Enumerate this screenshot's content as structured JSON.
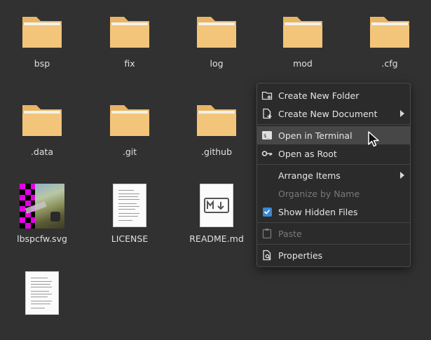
{
  "files": [
    {
      "name": "bsp",
      "type": "folder"
    },
    {
      "name": "fix",
      "type": "folder"
    },
    {
      "name": "log",
      "type": "folder"
    },
    {
      "name": "mod",
      "type": "folder"
    },
    {
      "name": ".cfg",
      "type": "folder"
    },
    {
      "name": ".data",
      "type": "folder"
    },
    {
      "name": ".git",
      "type": "folder"
    },
    {
      "name": ".github",
      "type": "folder"
    },
    {
      "name": "lbspcfw.svg",
      "type": "image"
    },
    {
      "name": "LICENSE",
      "type": "text-document"
    },
    {
      "name": "README.md",
      "type": "markdown-document"
    },
    {
      "name": "",
      "type": "text-document"
    }
  ],
  "menu": {
    "items": [
      {
        "label": "Create New Folder",
        "icon": "folder-plus-icon"
      },
      {
        "label": "Create New Document",
        "icon": "document-plus-icon",
        "submenu": true
      },
      {
        "label": "Open in Terminal",
        "icon": "terminal-icon",
        "highlighted": true
      },
      {
        "label": "Open as Root",
        "icon": "key-icon"
      },
      {
        "label": "Arrange Items",
        "submenu": true
      },
      {
        "label": "Organize by Name",
        "disabled": true
      },
      {
        "label": "Show Hidden Files",
        "icon": "checkbox-checked-icon",
        "checked": true
      },
      {
        "label": "Paste",
        "icon": "clipboard-icon",
        "disabled": true
      },
      {
        "label": "Properties",
        "icon": "properties-icon"
      }
    ]
  },
  "colors": {
    "background": "#313131",
    "folder": "#f2c57b",
    "folder_tab": "#e8b565",
    "menu_bg": "#2b2b2b",
    "menu_hover": "#474747",
    "accent": "#3a87d0"
  }
}
